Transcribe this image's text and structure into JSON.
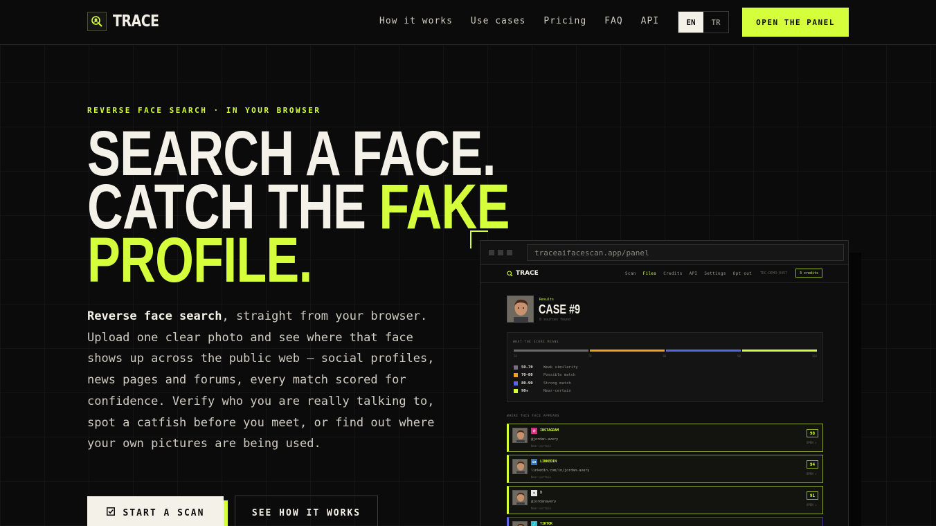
{
  "nav": {
    "brand": "TRACE",
    "logo_icon": "magnifier-face-icon",
    "links": [
      "How it works",
      "Use cases",
      "Pricing",
      "FAQ",
      "API"
    ],
    "lang_active": "EN",
    "lang_inactive": "TR",
    "cta": "OPEN THE PANEL"
  },
  "hero": {
    "eyebrow": "REVERSE FACE SEARCH · IN YOUR BROWSER",
    "headline_line1": "SEARCH A FACE.",
    "headline_line2_a": "CATCH THE ",
    "headline_line2_b": "FAKE",
    "headline_line3": "PROFILE.",
    "lede_bold": "Reverse face search",
    "lede_rest": ", straight from your browser. Upload one clear photo and see where that face shows up across the public web — social profiles, news pages and forums, every match scored for confidence. Verify who you are really talking to, spot a catfish before you meet, or find out where your own pictures are being used.",
    "primary_button": "START A SCAN",
    "primary_icon": "checkbox-icon",
    "secondary_button": "SEE HOW IT WORKS"
  },
  "mock": {
    "url": "traceaifacescan.app/panel",
    "app": {
      "brand": "TRACE",
      "links": [
        "Scan",
        "Files",
        "Credits",
        "API",
        "Settings",
        "Opt out"
      ],
      "active_link": "Files",
      "id": "TRC-DEMO-0457",
      "credits": "3 credits"
    },
    "case": {
      "label": "Results",
      "title": "CASE #9",
      "sub": "8 sources found"
    },
    "score": {
      "title": "WHAT THE SCORE MEANS",
      "ticks": [
        "50",
        "70",
        "80",
        "90",
        "100"
      ],
      "bar_colors": [
        "#6e6e6e",
        "#f0a020",
        "#5b66e6",
        "#d4ff3a"
      ],
      "legend": [
        {
          "range": "50-70",
          "desc": "Weak similarity",
          "color": "#7a6e80"
        },
        {
          "range": "70-80",
          "desc": "Possible match",
          "color": "#f0a020"
        },
        {
          "range": "80-90",
          "desc": "Strong match",
          "color": "#5b66e6"
        },
        {
          "range": "90+",
          "desc": "Near-certain",
          "color": "#d4ff3a"
        }
      ]
    },
    "where_title": "WHERE THIS FACE APPEARS",
    "matches": [
      {
        "platform": "INSTAGRAM",
        "icon": "instagram-icon",
        "icon_color": "#d62f80",
        "glyph": "◎",
        "handle": "@jordan.avery",
        "label": "Near-certain",
        "score": "98",
        "open": "OPEN ↗"
      },
      {
        "platform": "LINKEDIN",
        "icon": "linkedin-icon",
        "icon_color": "#2a74c9",
        "glyph": "in",
        "handle": "linkedin.com/in/jordan-avery",
        "label": "Near-certain",
        "score": "94",
        "open": "OPEN ↗"
      },
      {
        "platform": "X",
        "icon": "x-icon",
        "icon_color": "#e8e8e8",
        "glyph": "𝕏",
        "handle": "@jordanavery",
        "label": "Near-certain",
        "score": "91",
        "open": "OPEN ↗"
      },
      {
        "platform": "TIKTOK",
        "icon": "tiktok-icon",
        "icon_color": "#23c4cf",
        "glyph": "♪",
        "handle": "",
        "label": "",
        "score": "",
        "open": ""
      }
    ]
  }
}
